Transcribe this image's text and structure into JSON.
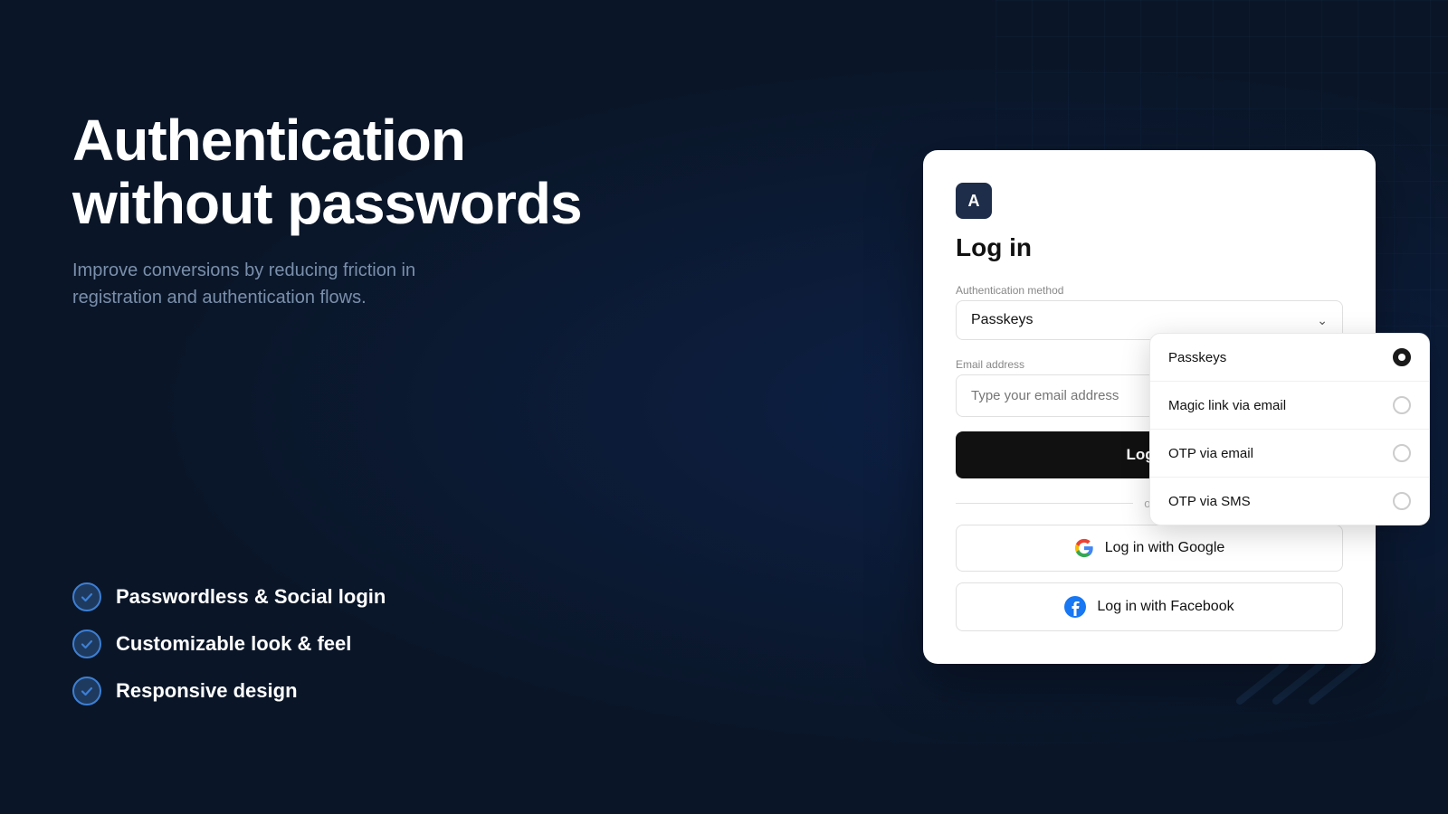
{
  "page": {
    "background_color": "#0a1628"
  },
  "left": {
    "heading_line1": "Authentication",
    "heading_line2": "without passwords",
    "subheading": "Improve conversions by reducing friction in registration and authentication flows.",
    "features": [
      {
        "id": "feature-1",
        "label": "Passwordless & Social login"
      },
      {
        "id": "feature-2",
        "label": "Customizable look & feel"
      },
      {
        "id": "feature-3",
        "label": "Responsive design"
      }
    ]
  },
  "card": {
    "app_icon_letter": "A",
    "title": "Log in",
    "auth_method_label": "Authentication method",
    "auth_method_selected": "Passkeys",
    "dropdown_options": [
      {
        "id": "passkeys",
        "label": "Passkeys",
        "selected": true
      },
      {
        "id": "magic-link",
        "label": "Magic link via email",
        "selected": false
      },
      {
        "id": "otp-email",
        "label": "OTP via email",
        "selected": false
      },
      {
        "id": "otp-sms",
        "label": "OTP via SMS",
        "selected": false
      }
    ],
    "email_label": "Email address",
    "email_placeholder": "Type your email address",
    "login_button_label": "Log in",
    "or_text": "or",
    "google_button_label": "Log in with Google",
    "facebook_button_label": "Log in with Facebook"
  }
}
